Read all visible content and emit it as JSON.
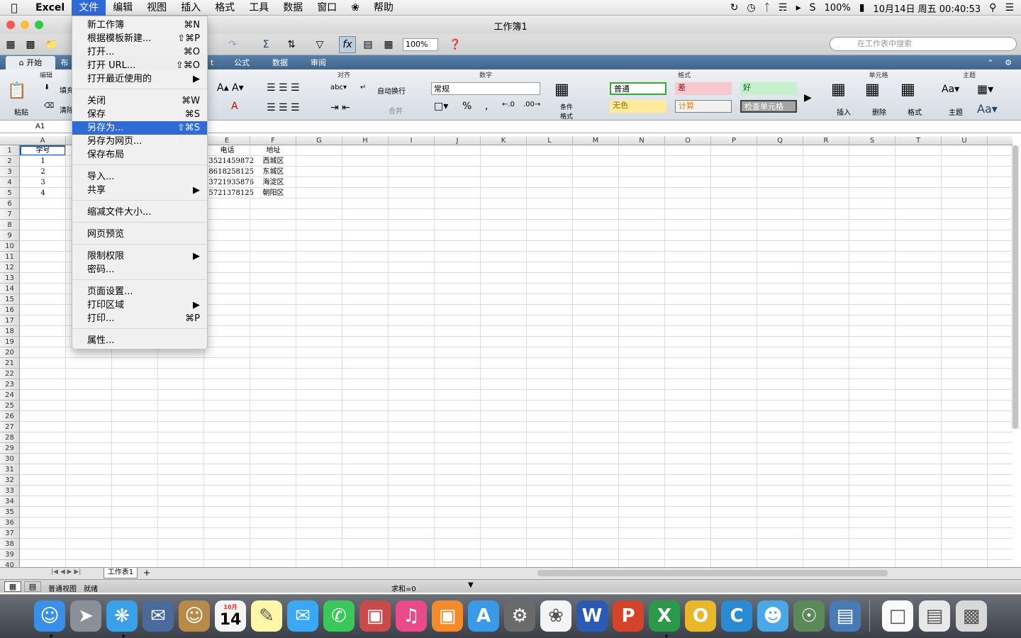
{
  "menubar": {
    "app": "Excel",
    "items": [
      "文件",
      "编辑",
      "视图",
      "插入",
      "格式",
      "工具",
      "数据",
      "窗口",
      "帮助"
    ],
    "active_index": 0
  },
  "status": {
    "battery": "100%",
    "datetime": "10月14日 周五 00:40:53"
  },
  "window": {
    "title": "工作簿1"
  },
  "toolbar": {
    "zoom": "100%",
    "search_placeholder": "在工作表中搜索"
  },
  "ribbon_tabs": [
    "开始",
    "布",
    "t",
    "公式",
    "数据",
    "审阅"
  ],
  "ribbon": {
    "groups": {
      "edit": "编辑",
      "align": "对齐",
      "number": "数字",
      "format": "格式",
      "cells": "单元格",
      "themes": "主题"
    },
    "paste": "粘贴",
    "fill": "填充",
    "clear": "清除",
    "wrap": "自动换行",
    "merge": "合并",
    "number_format": "常规",
    "conditional": "条件格式",
    "styles": [
      "普通",
      "差",
      "好",
      "无色",
      "计算",
      "检查单元格"
    ],
    "insert": "插入",
    "delete": "删除",
    "format_btn": "格式",
    "theme_btn": "主题"
  },
  "formula_bar": {
    "namebox": "A1"
  },
  "columns": [
    "A",
    "B",
    "C",
    "D",
    "E",
    "F",
    "G",
    "H",
    "I",
    "J",
    "K",
    "L",
    "M",
    "N",
    "O",
    "P",
    "Q",
    "R",
    "S",
    "T",
    "U"
  ],
  "rows": 40,
  "cells": {
    "A1": "学号",
    "A2": "1",
    "A3": "2",
    "A4": "3",
    "A5": "4",
    "E1": "电话",
    "E2": "13521459872",
    "E3": "18618258125",
    "E4": "13721935876",
    "E5": "15721378125",
    "F1": "地址",
    "F2": "西城区",
    "F3": "东城区",
    "F4": "海淀区",
    "F5": "朝阳区"
  },
  "file_menu": [
    {
      "label": "新工作簿",
      "shortcut": "⌘N"
    },
    {
      "label": "根据模板新建...",
      "shortcut": "⇧⌘P"
    },
    {
      "label": "打开...",
      "shortcut": "⌘O"
    },
    {
      "label": "打开 URL...",
      "shortcut": "⇧⌘O"
    },
    {
      "label": "打开最近使用的",
      "shortcut": "▶"
    },
    {
      "label": "关闭",
      "shortcut": "⌘W"
    },
    {
      "label": "保存",
      "shortcut": "⌘S"
    },
    {
      "label": "另存为...",
      "shortcut": "⇧⌘S"
    },
    {
      "label": "另存为网页...",
      "shortcut": ""
    },
    {
      "label": "保存布局",
      "shortcut": ""
    },
    {
      "label": "导入...",
      "shortcut": ""
    },
    {
      "label": "共享",
      "shortcut": "▶"
    },
    {
      "label": "缩减文件大小...",
      "shortcut": ""
    },
    {
      "label": "网页预览",
      "shortcut": ""
    },
    {
      "label": "限制权限",
      "shortcut": "▶"
    },
    {
      "label": "密码...",
      "shortcut": ""
    },
    {
      "label": "页面设置...",
      "shortcut": ""
    },
    {
      "label": "打印区域",
      "shortcut": "▶"
    },
    {
      "label": "打印...",
      "shortcut": "⌘P"
    },
    {
      "label": "属性...",
      "shortcut": ""
    }
  ],
  "sheet": {
    "tab": "工作表1",
    "view": "普通视图",
    "ready": "就绪",
    "sum": "求和=0"
  },
  "dock_icons": [
    "finder-icon",
    "launchpad-icon",
    "safari-icon",
    "mail-icon",
    "contacts-icon",
    "calendar-icon",
    "notes-icon",
    "messages-icon",
    "facetime-icon",
    "photo-booth-icon",
    "itunes-icon",
    "ibooks-icon",
    "app-store-icon",
    "system-preferences-icon",
    "photos-icon",
    "word-icon",
    "powerpoint-icon",
    "excel-icon",
    "outlook-icon",
    "c-app-icon",
    "messenger-icon",
    "network-icon",
    "remote-desktop-icon",
    "document-icon",
    "preview-icon",
    "trash-icon"
  ],
  "calendar_day": "14",
  "calendar_month": "10月"
}
